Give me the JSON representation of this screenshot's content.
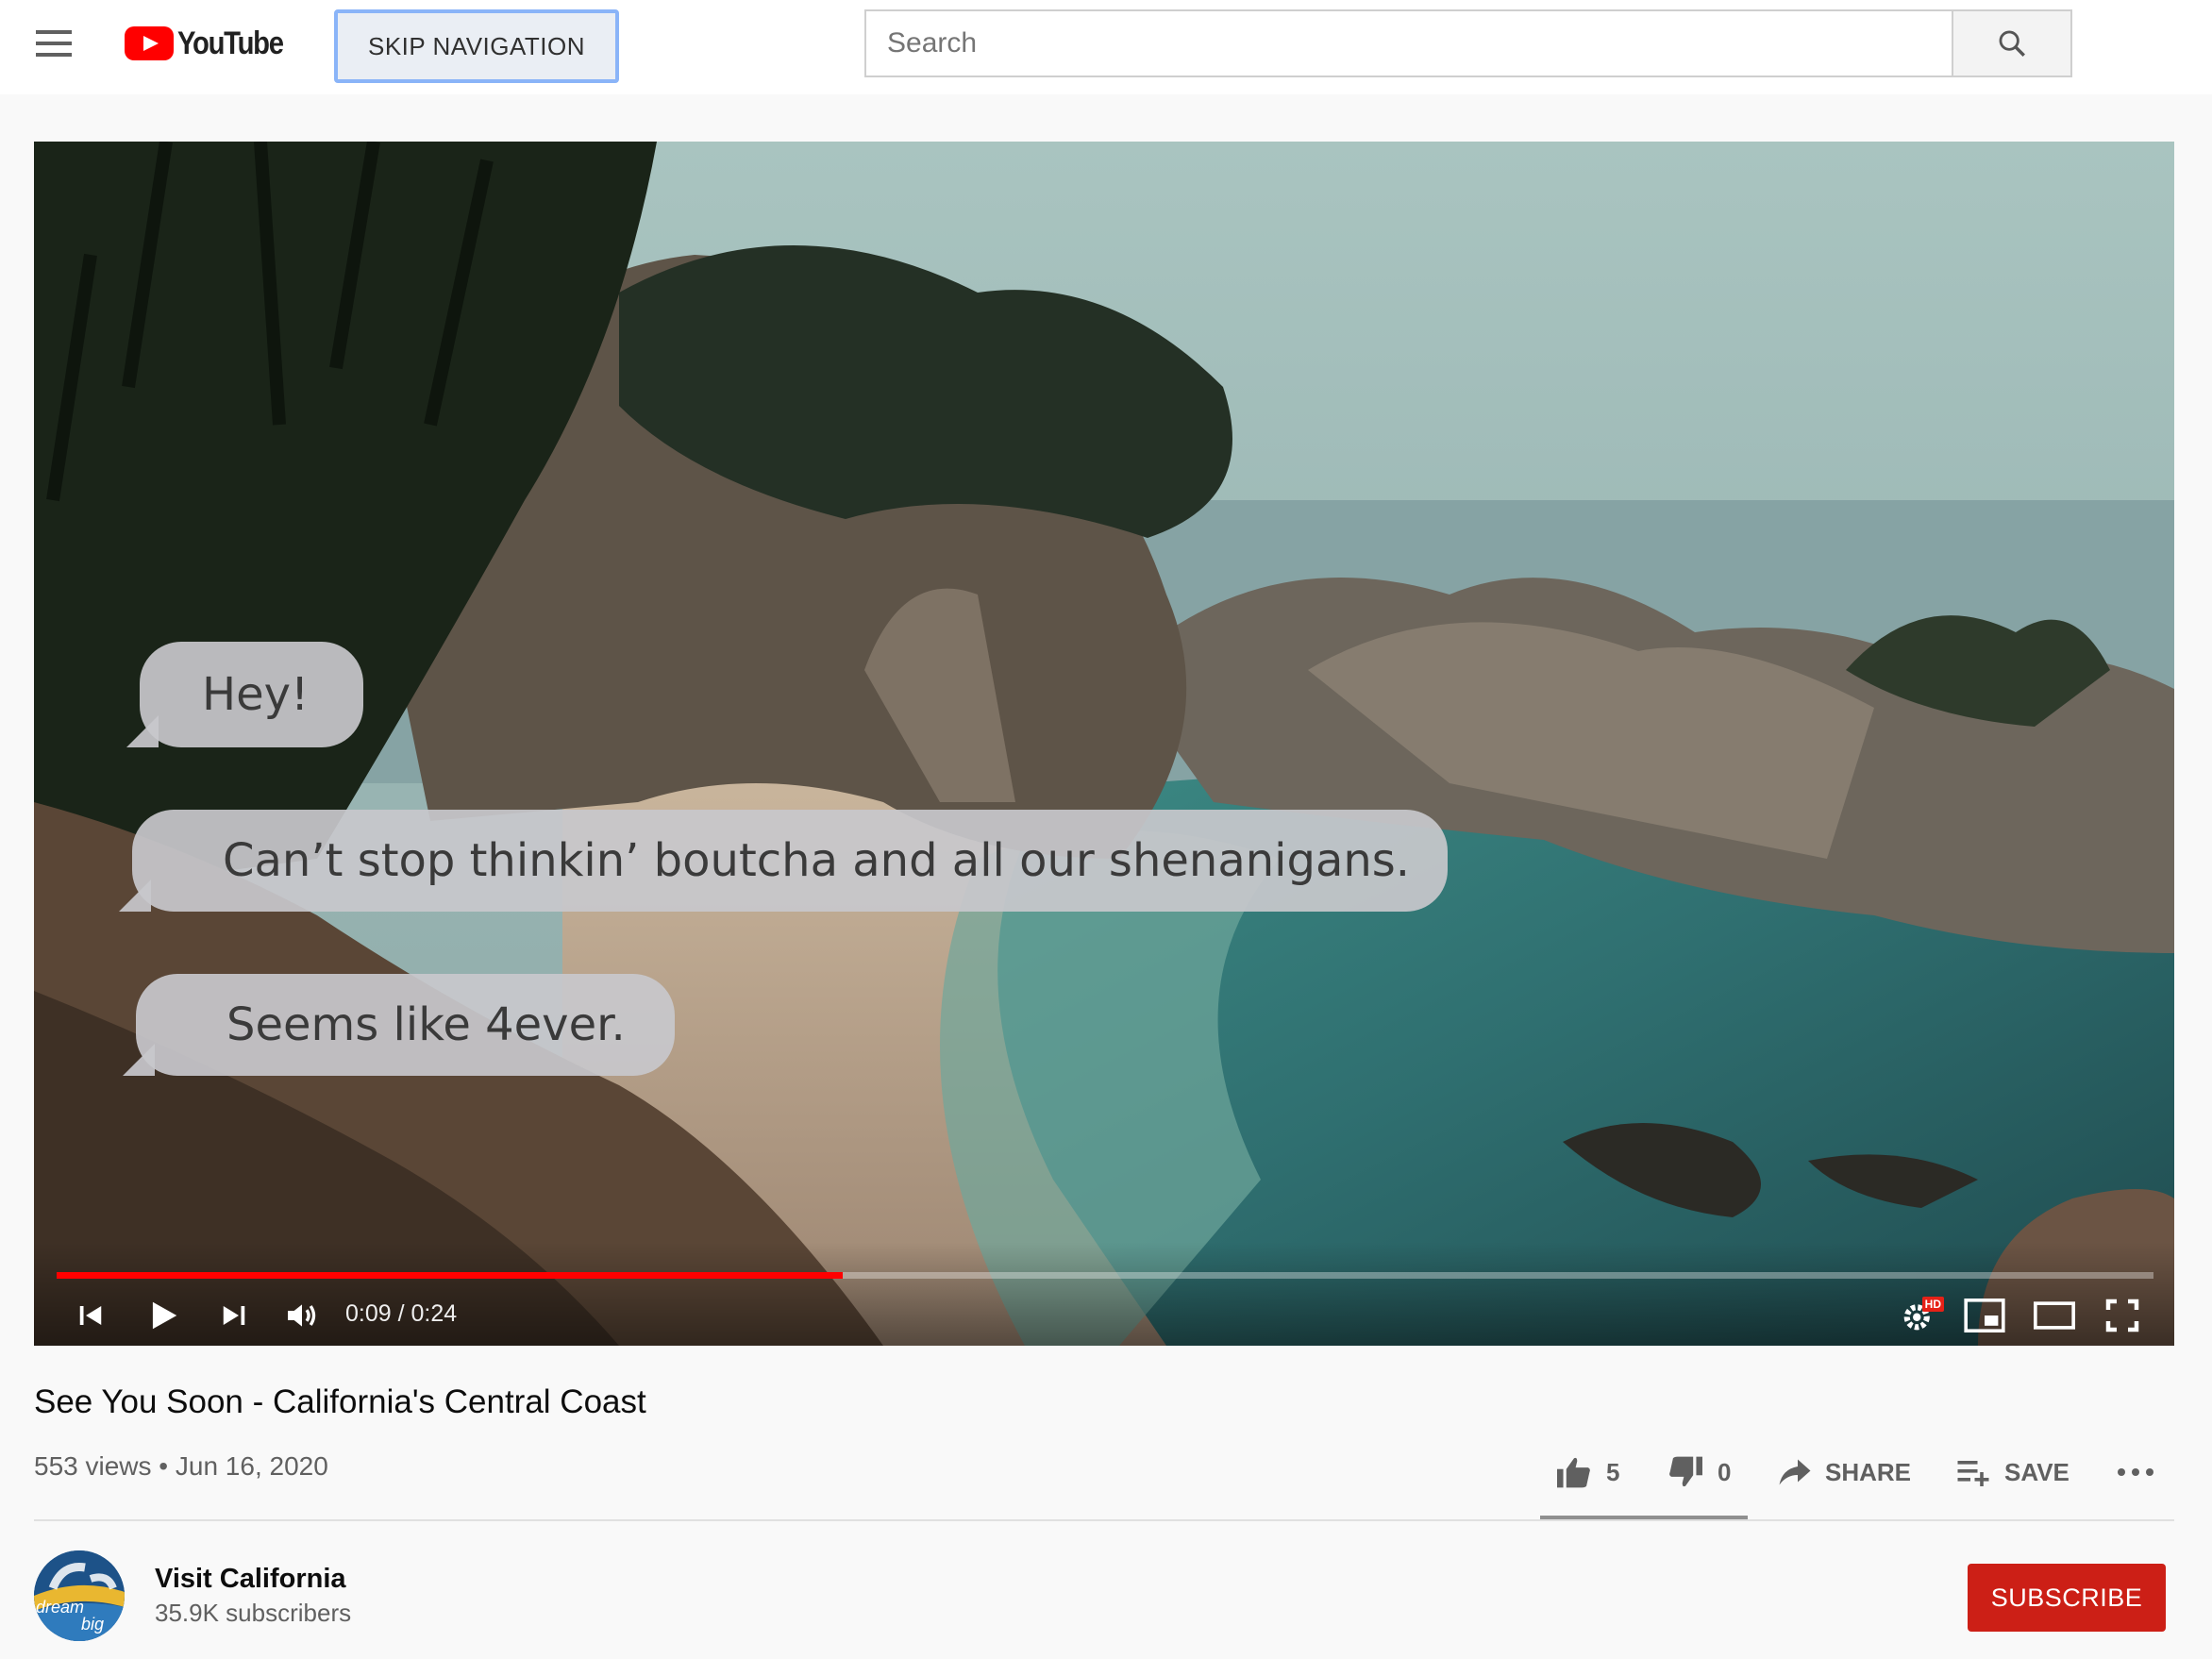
{
  "header": {
    "logo_text": "YouTube",
    "skip_nav_label": "SKIP NAVIGATION",
    "search_placeholder": "Search"
  },
  "player": {
    "captions": [
      "Hey!",
      "Can’t stop thinkin’ boutcha and all our shenanigans.",
      "Seems like 4ever."
    ],
    "current_time": "0:09",
    "duration": "0:24",
    "time_display": "0:09 / 0:24",
    "progress_fraction": 0.375,
    "quality_badge": "HD",
    "progress_color": "#ff0000"
  },
  "video": {
    "title": "See You Soon - California's Central Coast",
    "meta": "553 views • Jun 16, 2020",
    "likes": "5",
    "dislikes": "0",
    "share_label": "SHARE",
    "save_label": "SAVE"
  },
  "channel": {
    "name": "Visit California",
    "subscribers": "35.9K subscribers",
    "avatar_text_1": "dream",
    "avatar_text_2": "big"
  },
  "subscribe_label": "SUBSCRIBE",
  "colors": {
    "brand_red": "#ff0000",
    "subscribe_red": "#cc1f16",
    "skip_focus": "#8ab4f8"
  },
  "icons": [
    "menu-icon",
    "youtube-logo-icon",
    "search-icon",
    "previous-icon",
    "play-icon",
    "next-icon",
    "volume-icon",
    "settings-icon",
    "miniplayer-icon",
    "theater-mode-icon",
    "fullscreen-icon",
    "thumbs-up-icon",
    "thumbs-down-icon",
    "share-icon",
    "add-to-playlist-icon",
    "more-icon"
  ]
}
